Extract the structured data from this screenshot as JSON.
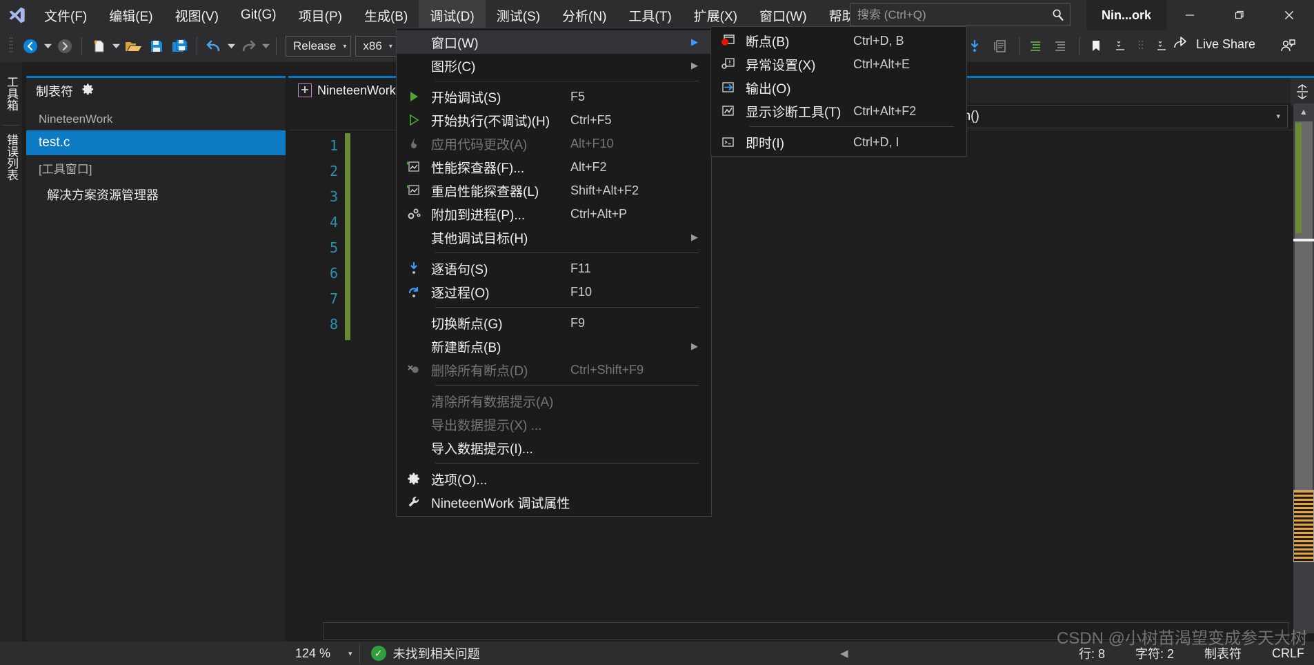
{
  "window": {
    "title": "Nin...ork",
    "minimize_label": "─",
    "restore_label": "❐",
    "close_label": "✕"
  },
  "menubar": {
    "items": [
      {
        "label": "文件(F)",
        "active": false
      },
      {
        "label": "编辑(E)",
        "active": false
      },
      {
        "label": "视图(V)",
        "active": false
      },
      {
        "label": "Git(G)",
        "active": false
      },
      {
        "label": "项目(P)",
        "active": false
      },
      {
        "label": "生成(B)",
        "active": false
      },
      {
        "label": "调试(D)",
        "active": true
      },
      {
        "label": "测试(S)",
        "active": false
      },
      {
        "label": "分析(N)",
        "active": false
      },
      {
        "label": "工具(T)",
        "active": false
      },
      {
        "label": "扩展(X)",
        "active": false
      },
      {
        "label": "窗口(W)",
        "active": false
      },
      {
        "label": "帮助(H)",
        "active": false
      }
    ]
  },
  "search": {
    "placeholder": "搜索 (Ctrl+Q)",
    "value": "",
    "icon": "search-icon"
  },
  "toolbar": {
    "configuration": "Release",
    "platform": "x86",
    "live_share": "Live Share",
    "caret": "▾"
  },
  "left_dock": {
    "tabs": [
      {
        "label": "工具箱"
      },
      {
        "label": "错误列表"
      }
    ]
  },
  "left_panel": {
    "header": "制表符",
    "gear_icon": "gear-icon",
    "project": "NineteenWork",
    "selected_file": "test.c",
    "group_label": "[工具窗口]",
    "sub_item": "解决方案资源管理器"
  },
  "editor": {
    "tab_label": "NineteenWork",
    "scope": "main()",
    "line_numbers": [
      "1",
      "2",
      "3",
      "4",
      "5",
      "6",
      "7",
      "8"
    ],
    "code_lines": [
      "",
      "",
      "",
      "",
      "",
      "",
      "",
      ""
    ]
  },
  "debug_menu": {
    "items": [
      {
        "label": "窗口(W)",
        "key": "",
        "icon": "",
        "submenu": true,
        "highlight": true,
        "disabled": false
      },
      {
        "label": "图形(C)",
        "key": "",
        "icon": "",
        "submenu": true,
        "highlight": false,
        "disabled": false
      },
      {
        "separator": true
      },
      {
        "label": "开始调试(S)",
        "key": "F5",
        "icon": "play-icon",
        "submenu": false,
        "highlight": false,
        "disabled": false
      },
      {
        "label": "开始执行(不调试)(H)",
        "key": "Ctrl+F5",
        "icon": "play-outline-icon",
        "submenu": false,
        "highlight": false,
        "disabled": false
      },
      {
        "label": "应用代码更改(A)",
        "key": "Alt+F10",
        "icon": "flame-icon",
        "submenu": false,
        "highlight": false,
        "disabled": true
      },
      {
        "label": "性能探查器(F)...",
        "key": "Alt+F2",
        "icon": "perf-chart-icon",
        "submenu": false,
        "highlight": false,
        "disabled": false
      },
      {
        "label": "重启性能探查器(L)",
        "key": "Shift+Alt+F2",
        "icon": "perf-chart-icon",
        "submenu": false,
        "highlight": false,
        "disabled": false
      },
      {
        "label": "附加到进程(P)...",
        "key": "Ctrl+Alt+P",
        "icon": "gears-icon",
        "submenu": false,
        "highlight": false,
        "disabled": false
      },
      {
        "label": "其他调试目标(H)",
        "key": "",
        "icon": "",
        "submenu": true,
        "highlight": false,
        "disabled": false
      },
      {
        "separator": true
      },
      {
        "label": "逐语句(S)",
        "key": "F11",
        "icon": "step-into-icon",
        "submenu": false,
        "highlight": false,
        "disabled": false
      },
      {
        "label": "逐过程(O)",
        "key": "F10",
        "icon": "step-over-icon",
        "submenu": false,
        "highlight": false,
        "disabled": false
      },
      {
        "separator": true
      },
      {
        "label": "切换断点(G)",
        "key": "F9",
        "icon": "",
        "submenu": false,
        "highlight": false,
        "disabled": false
      },
      {
        "label": "新建断点(B)",
        "key": "",
        "icon": "",
        "submenu": true,
        "highlight": false,
        "disabled": false
      },
      {
        "label": "删除所有断点(D)",
        "key": "Ctrl+Shift+F9",
        "icon": "delete-breakpoints-icon",
        "submenu": false,
        "highlight": false,
        "disabled": true
      },
      {
        "separator": true
      },
      {
        "label": "清除所有数据提示(A)",
        "key": "",
        "icon": "",
        "submenu": false,
        "highlight": false,
        "disabled": true
      },
      {
        "label": "导出数据提示(X) ...",
        "key": "",
        "icon": "",
        "submenu": false,
        "highlight": false,
        "disabled": true
      },
      {
        "label": "导入数据提示(I)...",
        "key": "",
        "icon": "",
        "submenu": false,
        "highlight": false,
        "disabled": false
      },
      {
        "separator": true
      },
      {
        "label": "选项(O)...",
        "key": "",
        "icon": "gear-icon",
        "submenu": false,
        "highlight": false,
        "disabled": false
      },
      {
        "label": "NineteenWork 调试属性",
        "key": "",
        "icon": "wrench-icon",
        "submenu": false,
        "highlight": false,
        "disabled": false
      }
    ]
  },
  "window_submenu": {
    "items": [
      {
        "label": "断点(B)",
        "key": "Ctrl+D, B",
        "icon": "breakpoint-window-icon"
      },
      {
        "label": "异常设置(X)",
        "key": "Ctrl+Alt+E",
        "icon": "exception-settings-icon"
      },
      {
        "label": "输出(O)",
        "key": "",
        "icon": "output-window-icon"
      },
      {
        "label": "显示诊断工具(T)",
        "key": "Ctrl+Alt+F2",
        "icon": "diagnostic-tools-icon"
      },
      {
        "separator": true
      },
      {
        "label": "即时(I)",
        "key": "Ctrl+D, I",
        "icon": "immediate-window-icon"
      }
    ]
  },
  "statusbar": {
    "zoom": "124 %",
    "zoom_caret": "▾",
    "issues": "未找到相关问题",
    "issues_icon": "check-circle-icon",
    "line": "行: 8",
    "column": "字符: 2",
    "tabs_mode": "制表符",
    "line_ending": "CRLF"
  },
  "watermark": {
    "text": "CSDN @小树苗渴望变成参天大树"
  },
  "colors": {
    "accent": "#007acc",
    "selection": "#0d7ac4",
    "menu_bg": "#1b1b1c",
    "chrome_bg": "#2d2d30",
    "editor_bg": "#1e1e1e",
    "success": "#2e9e3f",
    "linenum": "#2b91af",
    "changebar": "#6a8a35"
  }
}
